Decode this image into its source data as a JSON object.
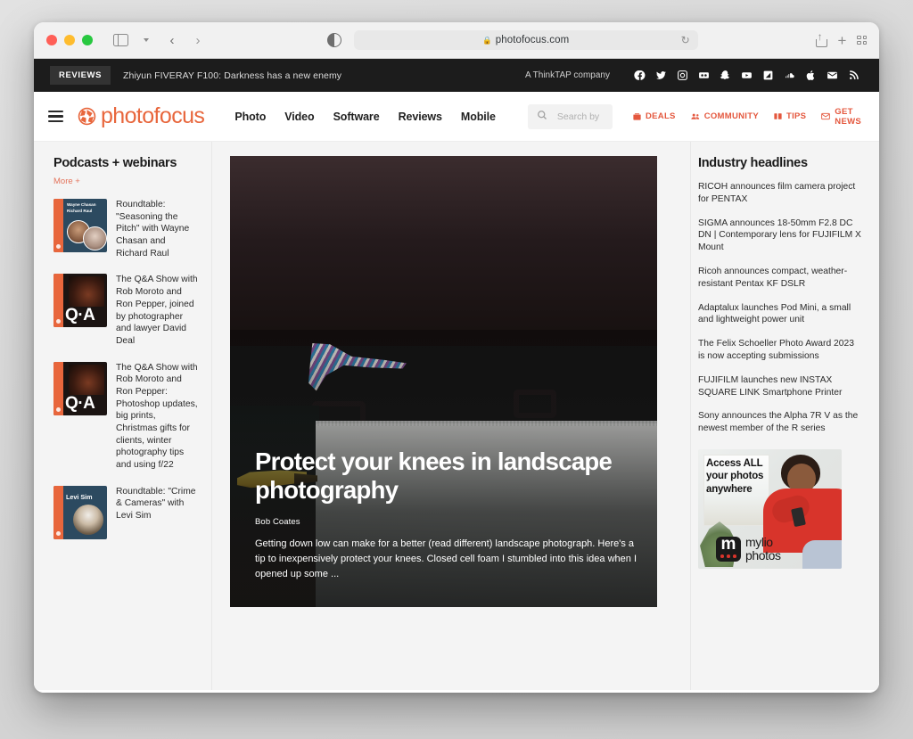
{
  "browser": {
    "url": "photofocus.com",
    "lock_icon": "lock-icon",
    "reload_icon": "reload-icon",
    "back_icon": "back-chevron-icon",
    "forward_icon": "forward-chevron-icon",
    "sidebar_icon": "sidebar-toggle-icon",
    "reader_icon": "reader-view-icon",
    "share_icon": "share-icon",
    "newtab_icon": "plus-icon",
    "taboverview_icon": "tab-overview-icon"
  },
  "topstrip": {
    "badge": "REVIEWS",
    "headline": "Zhiyun FIVERAY F100: Darkness has a new enemy",
    "company": "A ThinkTAP company",
    "social": [
      "facebook-icon",
      "twitter-icon",
      "instagram-icon",
      "flickr-icon",
      "snapchat-icon",
      "youtube-icon",
      "vimeo-icon",
      "soundcloud-icon",
      "apple-icon",
      "email-icon",
      "rss-icon"
    ]
  },
  "nav": {
    "menu_icon": "hamburger-icon",
    "brand": "photofocus",
    "brand_icon": "aperture-icon",
    "links": [
      "Photo",
      "Video",
      "Software",
      "Reviews",
      "Mobile"
    ],
    "search": {
      "icon": "search-icon",
      "placeholder": "Search by keyword",
      "value": ""
    },
    "utility": [
      {
        "label": "DEALS",
        "icon": "tag-icon"
      },
      {
        "label": "COMMUNITY",
        "icon": "people-icon"
      },
      {
        "label": "TIPS",
        "icon": "book-icon"
      },
      {
        "label": "GET NEWS",
        "icon": "envelope-icon"
      }
    ]
  },
  "left_sidebar": {
    "title": "Podcasts + webinars",
    "more_label": "More +",
    "items": [
      {
        "title": "Roundtable: \"Seasoning the Pitch\" with Wayne Chasan and Richard Raul",
        "thumb_kind": "roundtable",
        "thumb_text": "Wayne Chasan Richard Raul"
      },
      {
        "title": "The Q&A Show with Rob Moroto and Ron Pepper, joined by photographer and lawyer David Deal",
        "thumb_kind": "qa",
        "thumb_text": "Q·A"
      },
      {
        "title": "The Q&A Show with Rob Moroto and Ron Pepper: Photoshop updates, big prints, Christmas gifts for clients, winter photography tips and using f/22",
        "thumb_kind": "qa",
        "thumb_text": "Q·A"
      },
      {
        "title": "Roundtable: \"Crime & Cameras\" with Levi Sim",
        "thumb_kind": "levi",
        "thumb_text": "Levi Sim"
      }
    ]
  },
  "hero": {
    "title": "Protect your knees in landscape photography",
    "author": "Bob Coates",
    "excerpt": "Getting down low can make for a better (read different) landscape photograph. Here's a tip to inexpensively protect your knees. Closed cell foam I stumbled into this idea when I opened up some ..."
  },
  "right_sidebar": {
    "title": "Industry headlines",
    "headlines": [
      "RICOH announces film camera project for PENTAX",
      "SIGMA announces 18-50mm F2.8 DC DN | Contemporary lens for FUJIFILM X Mount",
      "Ricoh announces compact, weather-resistant Pentax KF DSLR",
      "Adaptalux launches Pod Mini, a small and lightweight power unit",
      "The Felix Schoeller Photo Award 2023 is now accepting submissions",
      "FUJIFILM launches new INSTAX SQUARE LINK Smartphone Printer",
      "Sony announces the Alpha 7R V as the newest member of the R series"
    ],
    "ad": {
      "headline": "Access ALL your photos anywhere",
      "brand_line1": "mylio",
      "brand_line2": "photos",
      "logo_icon": "mylio-logo-icon"
    }
  },
  "colors": {
    "brand_orange": "#e8663c",
    "accent_red": "#e4573d",
    "dark_bar": "#1c1c1c",
    "page_bg": "#f4f4f4"
  }
}
